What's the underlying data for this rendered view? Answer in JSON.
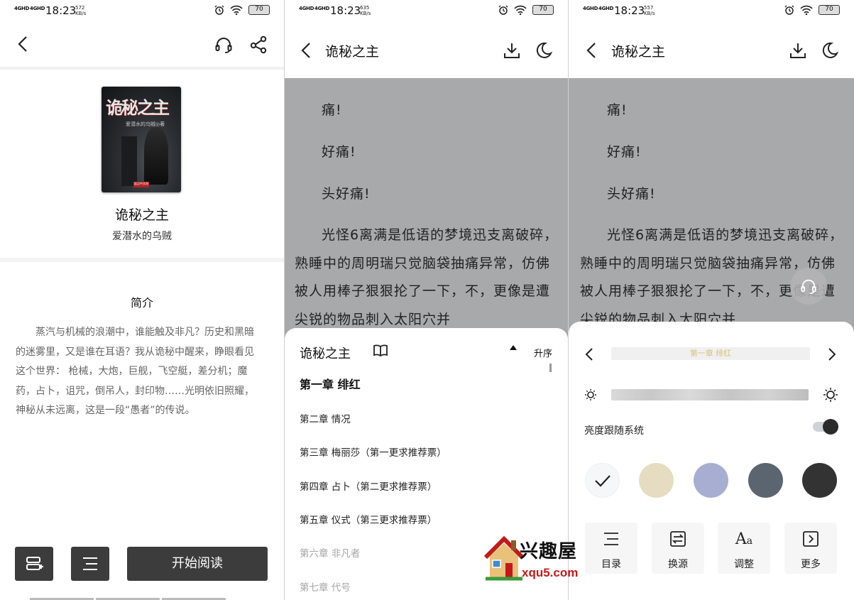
{
  "colors": {
    "dark_button": "#3c3c3c",
    "reader_bg": "#a7a9ab",
    "chapter_accent": "#d8c27a",
    "watermark_red": "#c21a1a"
  },
  "status_bars": [
    {
      "signal1": "4GHD",
      "signal2": "4GHD",
      "time": "18:23",
      "speed_value": "572",
      "speed_unit": "KB/s",
      "battery": "70"
    },
    {
      "signal1": "4GHD",
      "signal2": "4GHD",
      "time": "18:23",
      "speed_value": "635",
      "speed_unit": "KB/s",
      "battery": "70"
    },
    {
      "signal1": "4GHD",
      "signal2": "4GHD",
      "time": "18:23",
      "speed_value": "557",
      "speed_unit": "KB/s",
      "battery": "70"
    }
  ],
  "detail": {
    "cover": {
      "title_art": "诡秘之主",
      "author_art": "爱潜水的乌贼◎著",
      "seal": "起点中文网"
    },
    "book_title": "诡秘之主",
    "author": "爱潜水的乌贼",
    "intro_heading": "简介",
    "intro_text": "蒸汽与机械的浪潮中，谁能触及非凡？历史和黑暗的迷雾里，又是谁在耳语？我从诡秘中醒来，睁眼看见这个世界： 枪械，大炮，巨舰，飞空艇，差分机；魔药，占卜，诅咒，倒吊人，封印物……光明依旧照耀，神秘从未远离，这是一段“愚者”的传说。",
    "start_button": "开始阅读",
    "icons": [
      "back-icon",
      "headset-icon",
      "share-icon",
      "add-shelf-icon",
      "catalog-icon"
    ]
  },
  "reader": {
    "title": "诡秘之主",
    "paragraphs": [
      "痛!",
      "好痛!",
      "头好痛!",
      "光怪6离满是低语的梦境迅支离破碎，熟睡中的周明瑞只觉脑袋抽痛异常，仿佛被人用棒子狠狠抡了一下，不，更像是遭尖锐的物品刺入太阳穴并"
    ]
  },
  "chapters_sheet": {
    "book_title": "诡秘之主",
    "sort_label": "升序",
    "chapters": [
      {
        "title": "第一章 绯红",
        "state": "active"
      },
      {
        "title": "第二章 情况",
        "state": "normal"
      },
      {
        "title": "第三章 梅丽莎（第一更求推荐票）",
        "state": "normal"
      },
      {
        "title": "第四章 占卜（第二更求推荐票）",
        "state": "normal"
      },
      {
        "title": "第五章 仪式（第三更求推荐票）",
        "state": "normal"
      },
      {
        "title": "第六章 非凡者",
        "state": "dim"
      },
      {
        "title": "第七章 代号",
        "state": "dim"
      }
    ]
  },
  "settings_sheet": {
    "current_chapter": "第一章 绯红",
    "brightness_follow_label": "亮度跟随系统",
    "brightness_follow_on": true,
    "themes": [
      {
        "color": "#f5f7f8",
        "selected": true
      },
      {
        "color": "#e6dcc2",
        "selected": false
      },
      {
        "color": "#a7aed1",
        "selected": false
      },
      {
        "color": "#5b6570",
        "selected": false
      },
      {
        "color": "#333333",
        "selected": false
      }
    ],
    "buttons": [
      {
        "label": "目录",
        "icon": "list-icon"
      },
      {
        "label": "换源",
        "icon": "swap-source-icon"
      },
      {
        "label": "调整",
        "icon": "font-size-icon"
      },
      {
        "label": "更多",
        "icon": "more-icon"
      }
    ]
  },
  "watermark": {
    "text": "兴趣屋",
    "url": "xqu5.com"
  }
}
